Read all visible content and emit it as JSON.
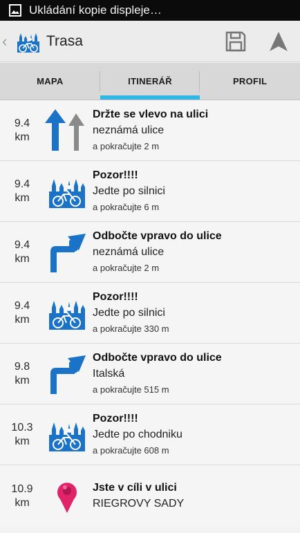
{
  "statusbar": {
    "text": "Ukládání kopie displeje…",
    "icon": "image-icon"
  },
  "actionbar": {
    "back": "‹",
    "title": "Trasa",
    "actions": [
      "save-icon",
      "navigate-icon"
    ]
  },
  "tabs": [
    {
      "label": "MAPA",
      "active": false
    },
    {
      "label": "ITINERÁŘ",
      "active": true
    },
    {
      "label": "PROFIL",
      "active": false
    }
  ],
  "colors": {
    "accent": "#33b5e5",
    "arrow": "#1a73c7",
    "gray_arrow": "#8a8a8a",
    "pin": "#e0246a"
  },
  "items": [
    {
      "dist_value": "9.4",
      "dist_unit": "km",
      "icon": "keep-left-icon",
      "title": "Držte se vlevo na ulici",
      "street": "neznámá ulice",
      "continue": "a pokračujte 2 m"
    },
    {
      "dist_value": "9.4",
      "dist_unit": "km",
      "icon": "cyclist-warning-icon",
      "title": "Pozor!!!!",
      "street": "Jedte po silnici",
      "continue": "a pokračujte 6 m"
    },
    {
      "dist_value": "9.4",
      "dist_unit": "km",
      "icon": "turn-right-icon",
      "title": "Odbočte vpravo do ulice",
      "street": "neznámá ulice",
      "continue": "a pokračujte 2 m"
    },
    {
      "dist_value": "9.4",
      "dist_unit": "km",
      "icon": "cyclist-warning-icon",
      "title": "Pozor!!!!",
      "street": "Jedte po silnici",
      "continue": "a pokračujte 330 m"
    },
    {
      "dist_value": "9.8",
      "dist_unit": "km",
      "icon": "turn-right-icon",
      "title": "Odbočte vpravo do ulice",
      "street": "Italská",
      "continue": "a pokračujte 515 m"
    },
    {
      "dist_value": "10.3",
      "dist_unit": "km",
      "icon": "cyclist-warning-icon",
      "title": "Pozor!!!!",
      "street": "Jedte po chodniku",
      "continue": "a pokračujte 608 m"
    },
    {
      "dist_value": "10.9",
      "dist_unit": "km",
      "icon": "destination-pin-icon",
      "title": "Jste v cíli v ulici",
      "street": "RIEGROVY SADY",
      "continue": ""
    }
  ]
}
